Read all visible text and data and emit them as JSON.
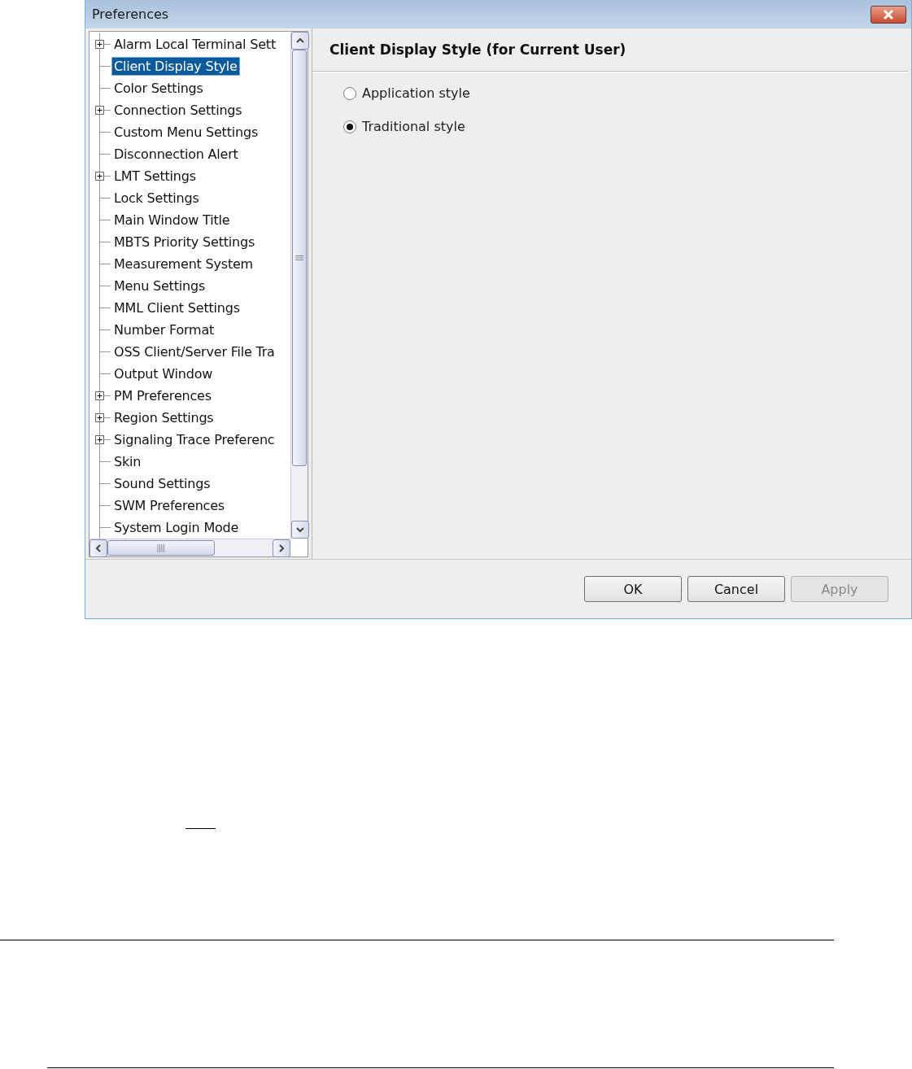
{
  "window": {
    "title": "Preferences"
  },
  "tree": {
    "items": [
      {
        "label": "Alarm Local Terminal Sett",
        "expandable": true,
        "selected": false
      },
      {
        "label": "Client Display Style",
        "expandable": false,
        "selected": true
      },
      {
        "label": "Color Settings",
        "expandable": false,
        "selected": false
      },
      {
        "label": "Connection Settings",
        "expandable": true,
        "selected": false
      },
      {
        "label": "Custom Menu Settings",
        "expandable": false,
        "selected": false
      },
      {
        "label": "Disconnection Alert",
        "expandable": false,
        "selected": false
      },
      {
        "label": "LMT Settings",
        "expandable": true,
        "selected": false
      },
      {
        "label": "Lock Settings",
        "expandable": false,
        "selected": false
      },
      {
        "label": "Main Window Title",
        "expandable": false,
        "selected": false
      },
      {
        "label": "MBTS Priority Settings",
        "expandable": false,
        "selected": false
      },
      {
        "label": "Measurement System",
        "expandable": false,
        "selected": false
      },
      {
        "label": "Menu Settings",
        "expandable": false,
        "selected": false
      },
      {
        "label": "MML Client Settings",
        "expandable": false,
        "selected": false
      },
      {
        "label": "Number Format",
        "expandable": false,
        "selected": false
      },
      {
        "label": "OSS Client/Server File Tra",
        "expandable": false,
        "selected": false
      },
      {
        "label": "Output Window",
        "expandable": false,
        "selected": false
      },
      {
        "label": "PM Preferences",
        "expandable": true,
        "selected": false
      },
      {
        "label": "Region Settings",
        "expandable": true,
        "selected": false
      },
      {
        "label": "Signaling Trace Preferenc",
        "expandable": true,
        "selected": false
      },
      {
        "label": "Skin",
        "expandable": false,
        "selected": false
      },
      {
        "label": "Sound Settings",
        "expandable": false,
        "selected": false
      },
      {
        "label": "SWM Preferences",
        "expandable": false,
        "selected": false
      },
      {
        "label": "System Login Mode",
        "expandable": false,
        "selected": false
      }
    ]
  },
  "panel": {
    "heading": "Client Display Style (for Current User)",
    "options": [
      {
        "label": "Application style",
        "selected": false
      },
      {
        "label": "Traditional style",
        "selected": true
      }
    ]
  },
  "buttons": [
    {
      "label": "OK",
      "disabled": false
    },
    {
      "label": "Cancel",
      "disabled": false
    },
    {
      "label": "Apply",
      "disabled": true
    }
  ]
}
